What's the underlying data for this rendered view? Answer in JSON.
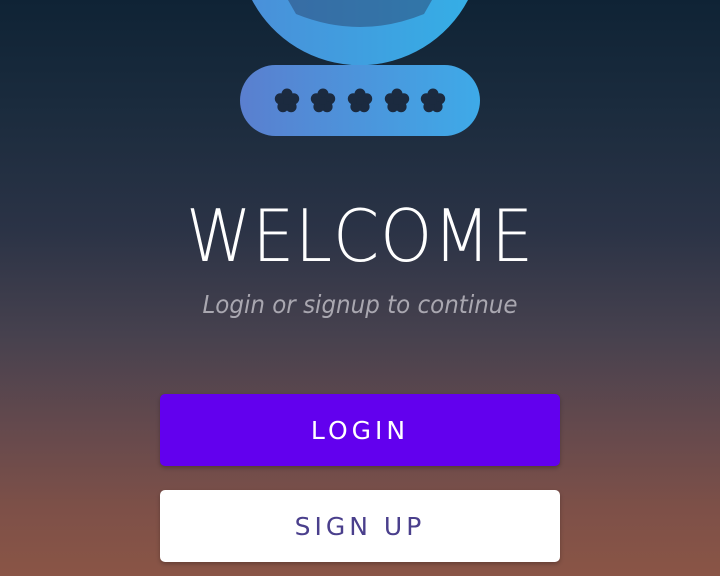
{
  "header": {
    "logo_icon": "user-password-icon",
    "password_mask": "*****"
  },
  "welcome": {
    "title": "WELCOME",
    "subtitle": "Login or signup to continue"
  },
  "actions": {
    "login_label": "LOGIN",
    "signup_label": "SIGN UP"
  },
  "colors": {
    "login_button": "#6200ee",
    "signup_button": "#ffffff",
    "signup_text": "#4a3f8c",
    "logo_gradient_start": "#5b7fd0",
    "logo_gradient_end": "#3aa8e8"
  }
}
